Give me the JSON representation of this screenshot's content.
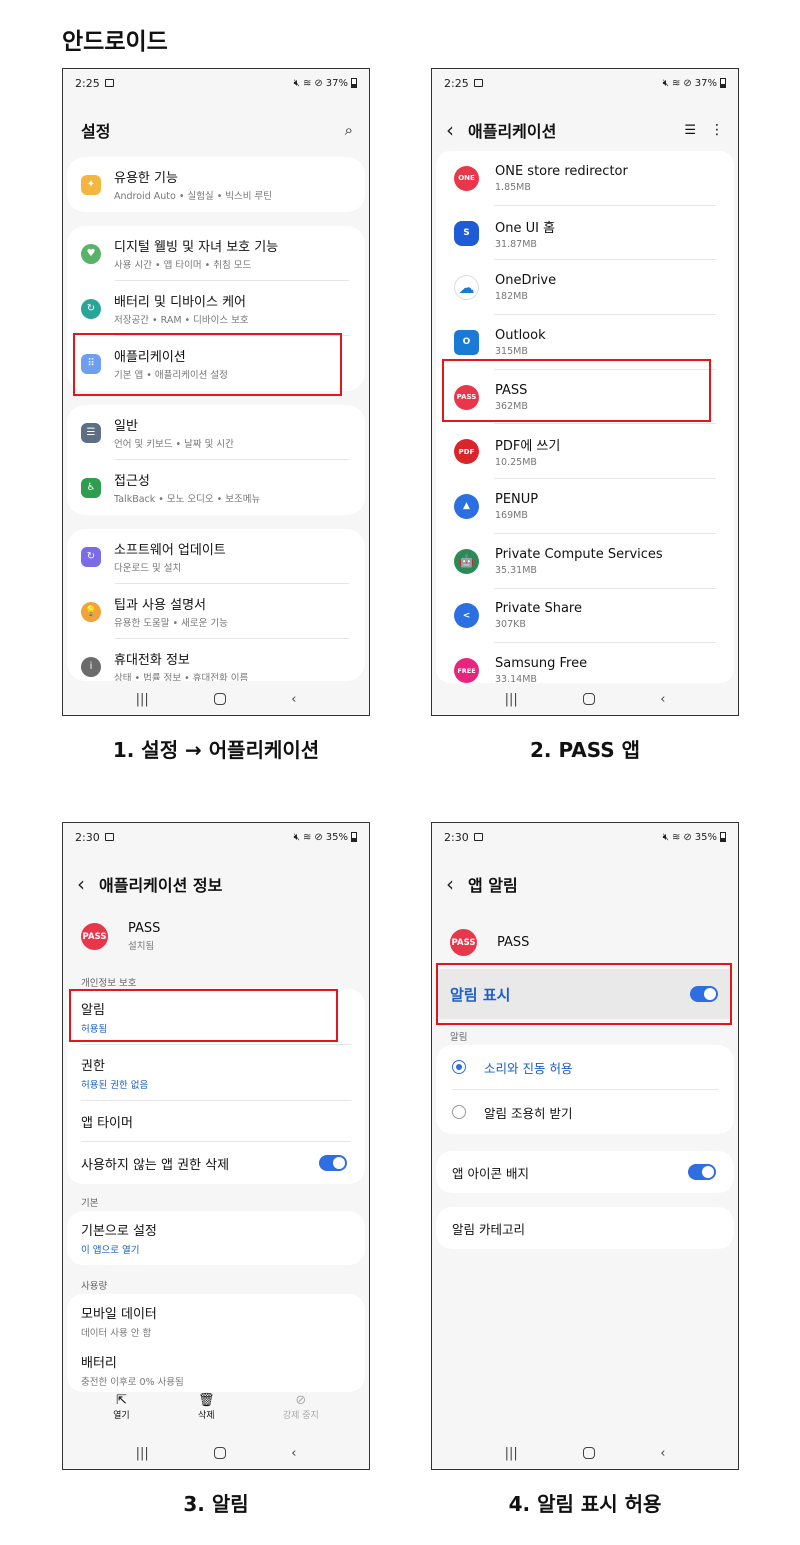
{
  "heading": "안드로이드",
  "captions": [
    "1. 설정 → 어플리케이션",
    "2. PASS 앱",
    "3. 알림",
    "4. 알림 표시 허용"
  ],
  "status1": {
    "time": "2:25",
    "battery": "37%"
  },
  "status2": {
    "time": "2:30",
    "battery": "35%"
  },
  "screen1": {
    "title": "설정",
    "rows": [
      {
        "title": "유용한 기능",
        "sub": "Android Auto • 실험실 • 빅스비 루틴"
      },
      {
        "title": "디지털 웰빙 및 자녀 보호 기능",
        "sub": "사용 시간 • 앱 타이머 • 취침 모드"
      },
      {
        "title": "배터리 및 디바이스 케어",
        "sub": "저장공간 • RAM • 디바이스 보호"
      },
      {
        "title": "애플리케이션",
        "sub": "기본 앱 • 애플리케이션 설정"
      },
      {
        "title": "일반",
        "sub": "언어 및 키보드 • 날짜 및 시간"
      },
      {
        "title": "접근성",
        "sub": "TalkBack • 모노 오디오 • 보조메뉴"
      },
      {
        "title": "소프트웨어 업데이트",
        "sub": "다운로드 및 설치"
      },
      {
        "title": "팁과 사용 설명서",
        "sub": "유용한 도움말 • 새로운 기능"
      },
      {
        "title": "휴대전화 정보",
        "sub": "상태 • 법률 정보 • 휴대전화 이름"
      }
    ]
  },
  "screen2": {
    "title": "애플리케이션",
    "apps": [
      {
        "name": "ONE store redirector",
        "size": "1.85MB",
        "icon_text": "ONE",
        "color": "#e8364a"
      },
      {
        "name": "One UI 홈",
        "size": "31.87MB",
        "icon_text": "S",
        "color": "#1e5bd6"
      },
      {
        "name": "OneDrive",
        "size": "182MB",
        "icon_text": "☁",
        "color": "#ffffff"
      },
      {
        "name": "Outlook",
        "size": "315MB",
        "icon_text": "O",
        "color": "#1a7ad4"
      },
      {
        "name": "PASS",
        "size": "362MB",
        "icon_text": "PASS",
        "color": "#e8364a"
      },
      {
        "name": "PDF에 쓰기",
        "size": "10.25MB",
        "icon_text": "PDF",
        "color": "#d8262b"
      },
      {
        "name": "PENUP",
        "size": "169MB",
        "icon_text": "▲",
        "color": "#2b6fe0"
      },
      {
        "name": "Private Compute Services",
        "size": "35.31MB",
        "icon_text": "🤖",
        "color": "#2d8a57"
      },
      {
        "name": "Private Share",
        "size": "307KB",
        "icon_text": "<",
        "color": "#2b6fe0"
      },
      {
        "name": "Samsung Free",
        "size": "33.14MB",
        "icon_text": "FREE",
        "color": "#e8247f"
      }
    ]
  },
  "screen3": {
    "title": "애플리케이션 정보",
    "app_name": "PASS",
    "app_status": "설치됨",
    "logo_text": "PASS",
    "section_privacy": "개인정보 보호",
    "notif_title": "알림",
    "notif_sub": "허용됨",
    "perm_title": "권한",
    "perm_sub": "허용된 권한 없음",
    "timer_title": "앱 타이머",
    "remove_title": "사용하지 않는 앱 권한 삭제",
    "section_default": "기본",
    "default_title": "기본으로 설정",
    "default_sub": "이 앱으로 열기",
    "section_usage": "사용량",
    "mobile_title": "모바일 데이터",
    "mobile_sub": "데이터 사용 안 함",
    "battery_title": "배터리",
    "battery_sub": "충전한 이후로 0% 사용됨",
    "actions": [
      "열기",
      "삭제",
      "강제 중지"
    ]
  },
  "screen4": {
    "title": "앱 알림",
    "app_name": "PASS",
    "logo_text": "PASS",
    "show_title": "알림 표시",
    "section": "알림",
    "option1": "소리와 진동 허용",
    "option2": "알림 조용히 받기",
    "badge_title": "앱 아이콘 배지",
    "category_title": "알림 카테고리"
  }
}
